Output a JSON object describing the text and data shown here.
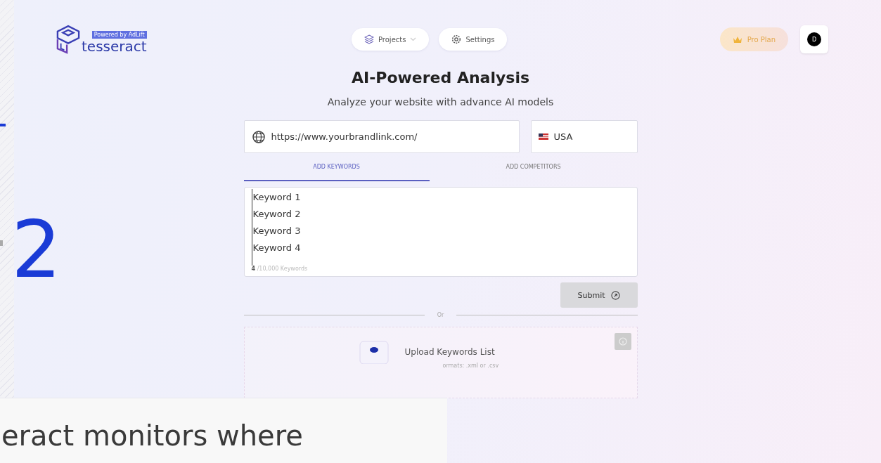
{
  "brand": {
    "name": "tesseract",
    "badge": "Powered by AdLift"
  },
  "nav": [
    {
      "kind": "projects",
      "label": "Projects"
    },
    {
      "kind": "settings",
      "label": "Settings"
    }
  ],
  "plan": {
    "label": "Pro Plan"
  },
  "avatar": {
    "initial": "D"
  },
  "heading": "AI-Powered Analysis",
  "subheading": "Analyze your website with advance AI models",
  "url_field": {
    "value": "https://www.yourbrandlink.com/"
  },
  "country_field": {
    "value": "USA"
  },
  "tabs": [
    {
      "label": "ADD KEYWORDS",
      "selected": true
    },
    {
      "label": "ADD COMPETITORS",
      "selected": false
    }
  ],
  "keywords": [
    "Keyword 1",
    "Keyword 2",
    "Keyword 3",
    "Keyword 4"
  ],
  "keyword_count": {
    "count": "4",
    "limit": "/10,000 Keywords"
  },
  "submit": {
    "label": "Submit"
  },
  "divider": "Or",
  "upload": {
    "title": "Upload Keywords List",
    "hint": "ormats: .xml or .csv"
  },
  "step_number": "2",
  "overlay_text": "eract monitors where"
}
